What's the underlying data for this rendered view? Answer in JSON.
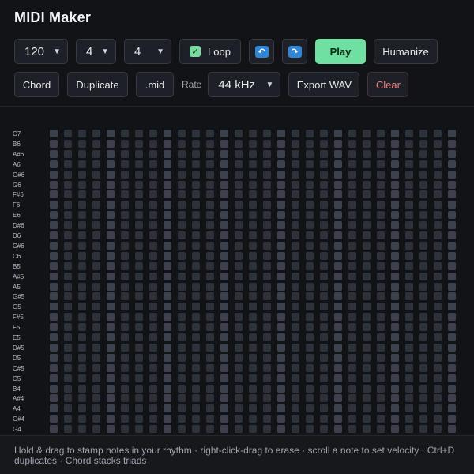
{
  "app": {
    "title": "MIDI Maker"
  },
  "toolbar": {
    "tempo": "120",
    "beats": "4",
    "subdivision": "4",
    "loop_label": "Loop",
    "loop_checked": true,
    "undo_icon": "undo-arrow-icon",
    "redo_icon": "redo-arrow-icon",
    "play_label": "Play",
    "humanize_label": "Humanize",
    "chord_label": "Chord",
    "duplicate_label": "Duplicate",
    "mid_label": ".mid",
    "rate_label": "Rate",
    "rate_value": "44 kHz",
    "export_label": "Export WAV",
    "clear_label": "Clear"
  },
  "colors": {
    "background": "#111317",
    "accent_play": "#6fe0a2",
    "loop_check": "#7ad9a0",
    "clear_text": "#ef7d7d",
    "cell": "#2d3139",
    "cell_beat": "#3d414e",
    "icon_blue": "#2f86d6"
  },
  "grid": {
    "pitches": [
      "C7",
      "B6",
      "A#6",
      "A6",
      "G#6",
      "G6",
      "F#6",
      "F6",
      "E6",
      "D#6",
      "D6",
      "C#6",
      "C6",
      "B5",
      "A#5",
      "A5",
      "G#5",
      "G5",
      "F#5",
      "F5",
      "E5",
      "D#5",
      "D5",
      "C#5",
      "C5",
      "B4",
      "A#4",
      "A4",
      "G#4",
      "G4"
    ],
    "steps": 29,
    "beat_every": 4
  },
  "footer": {
    "hint": "Hold & drag to stamp notes in your rhythm · right-click-drag to erase · scroll a note to set velocity · Ctrl+D duplicates · Chord stacks triads"
  }
}
